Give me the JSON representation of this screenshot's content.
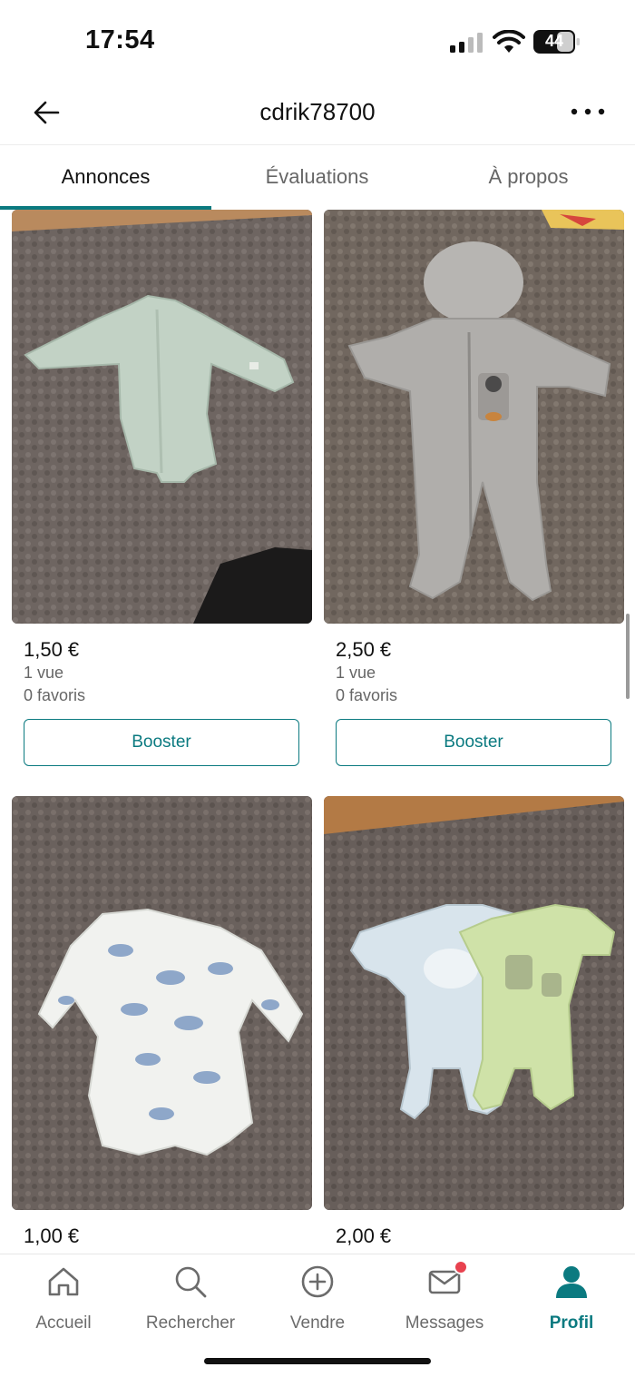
{
  "status_bar": {
    "time": "17:54",
    "battery": "44"
  },
  "header": {
    "title": "cdrik78700"
  },
  "tabs": [
    {
      "label": "Annonces",
      "active": true
    },
    {
      "label": "Évaluations",
      "active": false
    },
    {
      "label": "À propos",
      "active": false
    }
  ],
  "listings": [
    {
      "price": "1,50 €",
      "views": "1 vue",
      "favorites": "0 favoris",
      "action": "Booster",
      "image": "mint-green-kimono-bodysuit"
    },
    {
      "price": "2,50 €",
      "views": "1 vue",
      "favorites": "0 favoris",
      "action": "Booster",
      "image": "grey-fleece-hooded-pramsuit"
    },
    {
      "price": "1,00 €",
      "views": "",
      "favorites": "",
      "action": "",
      "image": "white-sloth-print-bodysuit"
    },
    {
      "price": "2,00 €",
      "views": "",
      "favorites": "",
      "action": "",
      "image": "two-sleepsuits-white-and-green"
    }
  ],
  "bottom_nav": [
    {
      "label": "Accueil",
      "icon": "home-icon",
      "active": false
    },
    {
      "label": "Rechercher",
      "icon": "search-icon",
      "active": false
    },
    {
      "label": "Vendre",
      "icon": "plus-circle-icon",
      "active": false
    },
    {
      "label": "Messages",
      "icon": "mail-icon",
      "active": false,
      "badge": true
    },
    {
      "label": "Profil",
      "icon": "profile-icon",
      "active": true
    }
  ],
  "colors": {
    "accent": "#0b7a80",
    "badge": "#e8424f",
    "muted": "#666666"
  }
}
